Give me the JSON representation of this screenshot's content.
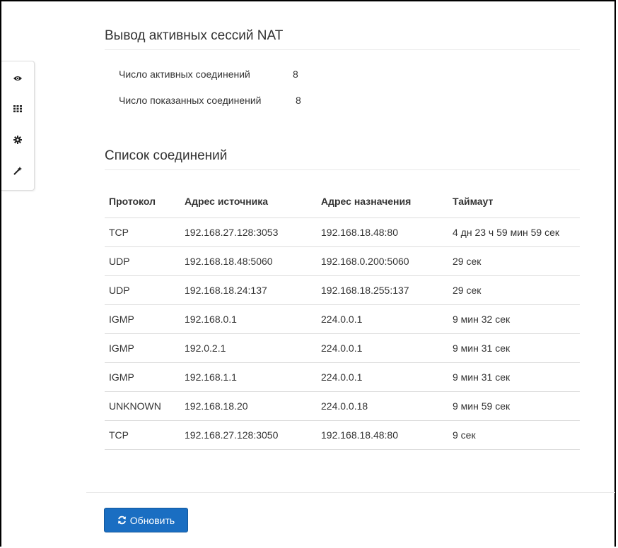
{
  "nat_section": {
    "title": "Вывод активных сессий NAT",
    "active_label": "Число активных соединений",
    "active_value": "8",
    "shown_label": "Число показанных соединений",
    "shown_value": "8"
  },
  "list_section": {
    "title": "Список соединений"
  },
  "table": {
    "headers": [
      "Протокол",
      "Адрес источника",
      "Адрес назначения",
      "Таймаут"
    ],
    "rows": [
      [
        "TCP",
        "192.168.27.128:3053",
        "192.168.18.48:80",
        "4 дн 23 ч 59 мин 59 сек"
      ],
      [
        "UDP",
        "192.168.18.48:5060",
        "192.168.0.200:5060",
        "29 сек"
      ],
      [
        "UDP",
        "192.168.18.24:137",
        "192.168.18.255:137",
        "29 сек"
      ],
      [
        "IGMP",
        "192.168.0.1",
        "224.0.0.1",
        "9 мин 32 сек"
      ],
      [
        "IGMP",
        "192.0.2.1",
        "224.0.0.1",
        "9 мин 31 сек"
      ],
      [
        "IGMP",
        "192.168.1.1",
        "224.0.0.1",
        "9 мин 31 сек"
      ],
      [
        "UNKNOWN",
        "192.168.18.20",
        "224.0.0.18",
        "9 мин 59 сек"
      ],
      [
        "TCP",
        "192.168.27.128:3050",
        "192.168.18.48:80",
        "9 сек"
      ]
    ]
  },
  "sidebar": {
    "icons": [
      "eye-icon",
      "grid-icon",
      "gear-icon",
      "wand-icon"
    ]
  },
  "refresh_button": {
    "label": "Обновить",
    "icon": "refresh-icon",
    "color": "#1a6ec2"
  }
}
